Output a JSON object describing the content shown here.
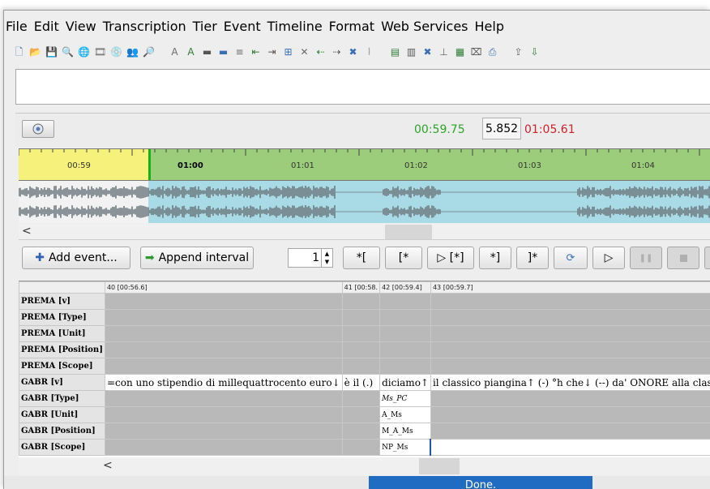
{
  "menu": [
    "File",
    "Edit",
    "View",
    "Transcription",
    "Tier",
    "Event",
    "Timeline",
    "Format",
    "Web Services",
    "Help"
  ],
  "toolbar": {
    "icons": [
      "new-icon",
      "open-icon",
      "save-icon",
      "search-icon",
      "web-icon",
      "film-icon",
      "cd-icon",
      "users-icon",
      "find-icon",
      "abc-left-icon",
      "abc-right-icon",
      "merge-icon",
      "split-icon",
      "align-icon",
      "shift-left-icon",
      "shift-right-icon",
      "insert-icon",
      "delete-event-icon",
      "insert-left-icon",
      "insert-right-icon",
      "cross-icon",
      "pause-icon",
      "tier-add-icon",
      "tier-props-icon",
      "tier-remove-icon",
      "tier-up-icon",
      "tier-grid-icon",
      "tier-delete-icon",
      "tier-print-icon",
      "export-icon",
      "import-icon"
    ]
  },
  "timebar": {
    "start": "00:59.75",
    "length": "5.852",
    "end": "01:05.61",
    "start_color": "#2aa52a",
    "end_color": "#d0202a"
  },
  "ruler": {
    "labels": [
      "00:59",
      "01:00",
      "01:01",
      "01:02",
      "01:03",
      "01:04"
    ],
    "selection_color": "#f6f17a",
    "region_color": "#9ccd7b"
  },
  "controls": {
    "add_event": "Add event...",
    "append_interval": "Append interval",
    "spinner_value": "1",
    "btn_open_start": "*[",
    "btn_bracket_star": "[*",
    "btn_play_bracket": "▷ [*]",
    "btn_star_close": "*]",
    "btn_close_star": "]*",
    "btn_play": "▷"
  },
  "grid": {
    "columns": [
      "40 [00:56.6]",
      "41 [00:58.",
      "42 [00:59.4]",
      "43 [00:59.7]"
    ],
    "tiers": [
      {
        "name": "PREMA [v]",
        "cells": [
          "",
          "",
          "",
          ""
        ]
      },
      {
        "name": "PREMA [Type]",
        "cells": [
          "",
          "",
          "",
          ""
        ]
      },
      {
        "name": "PREMA [Unit]",
        "cells": [
          "",
          "",
          "",
          ""
        ]
      },
      {
        "name": "PREMA [Position]",
        "cells": [
          "",
          "",
          "",
          ""
        ]
      },
      {
        "name": "PREMA [Scope]",
        "cells": [
          "",
          "",
          "",
          ""
        ]
      },
      {
        "name": "GABR [v]",
        "cells": [
          "=con uno stipendio di millequattrocento euro↓",
          "è il (.)",
          "diciamo↑",
          "il classico piangina↑ (-) °h che↓ (--) da' ONORE alla classe dei bamboccioni↓"
        ]
      },
      {
        "name": "GABR [Type]",
        "cells": [
          "",
          "",
          "Ms_PC",
          ""
        ]
      },
      {
        "name": "GABR [Unit]",
        "cells": [
          "",
          "",
          "A_Ms",
          ""
        ]
      },
      {
        "name": "GABR [Position]",
        "cells": [
          "",
          "",
          "M_A_Ms",
          ""
        ]
      },
      {
        "name": "GABR [Scope]",
        "cells": [
          "",
          "",
          "NP_Ms",
          ""
        ]
      }
    ]
  },
  "status": {
    "text": "Done.",
    "color": "#1f6cc2"
  }
}
